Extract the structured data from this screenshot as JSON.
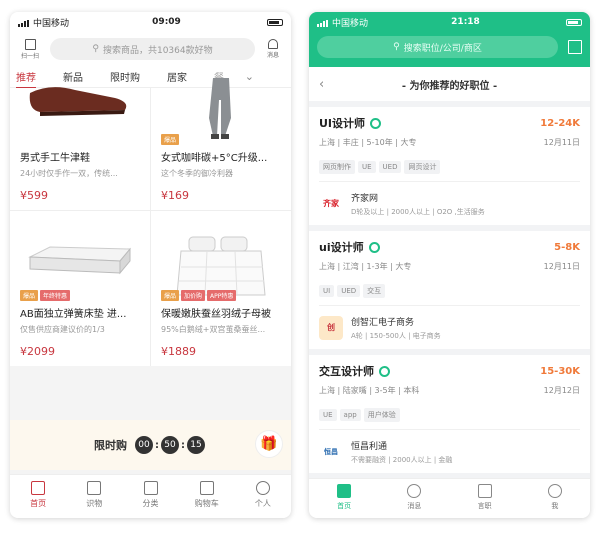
{
  "left_phone": {
    "status": {
      "carrier": "中国移动",
      "time": "09:09"
    },
    "header": {
      "scan_label": "扫一扫",
      "search_placeholder": "搜索商品，共10364款好物",
      "message_label": "消息"
    },
    "tabs": [
      "推荐",
      "新品",
      "限时购",
      "居家",
      "餐"
    ],
    "products": [
      {
        "tags": [],
        "title": "男式手工牛津鞋",
        "desc": "24小时仅手作一双，传统...",
        "price": "¥599"
      },
      {
        "tags": [
          "爆品"
        ],
        "title": "女式咖啡碳+5°C升级...",
        "desc": "这个冬季的御冷利器",
        "price": "¥169"
      },
      {
        "tags": [
          "爆品",
          "年终特惠"
        ],
        "title": "AB面独立弹簧床垫 进...",
        "desc": "仅售供应商建议价的1/3",
        "price": "¥2099"
      },
      {
        "tags": [
          "爆品",
          "加价购",
          "APP特惠"
        ],
        "title": "保暖嫩肤蚕丝羽绒子母被",
        "desc": "95%白鹅绒+双宫茧桑蚕丝...",
        "price": "¥1889"
      }
    ],
    "flash_sale": {
      "label": "限时购",
      "hours": "00",
      "minutes": "50",
      "seconds": "15"
    },
    "nav": [
      "首页",
      "识物",
      "分类",
      "购物车",
      "个人"
    ]
  },
  "right_phone": {
    "status": {
      "carrier": "中国移动",
      "time": "21:18"
    },
    "search_placeholder": "搜索职位/公司/商区",
    "page_title": "- 为你推荐的好职位 -",
    "jobs": [
      {
        "title": "UI设计师",
        "salary": "12-24K",
        "info": "上海 | 丰庄 | 5-10年 | 大专",
        "date": "12月11日",
        "tags": [
          "网页制作",
          "UE",
          "UED",
          "网页设计"
        ],
        "company": "齐家网",
        "company_info": "D轮及以上 | 2000人以上 | O2O ,生活服务"
      },
      {
        "title": "ui设计师",
        "salary": "5-8K",
        "info": "上海 | 江湾 | 1-3年 | 大专",
        "date": "12月11日",
        "tags": [
          "UI",
          "UED",
          "交互"
        ],
        "company": "创智汇电子商务",
        "company_info": "A轮 | 150-500人 | 电子商务"
      },
      {
        "title": "交互设计师",
        "salary": "15-30K",
        "info": "上海 | 陆家嘴 | 3-5年 | 本科",
        "date": "12月12日",
        "tags": [
          "UE",
          "app",
          "用户体验"
        ],
        "company": "恒昌利通",
        "company_info": "不需要融资 | 2000人以上 | 金融"
      }
    ],
    "logos": [
      "齐家",
      "创",
      "恒昌"
    ],
    "nav": [
      "首页",
      "消息",
      "言职",
      "我"
    ]
  }
}
